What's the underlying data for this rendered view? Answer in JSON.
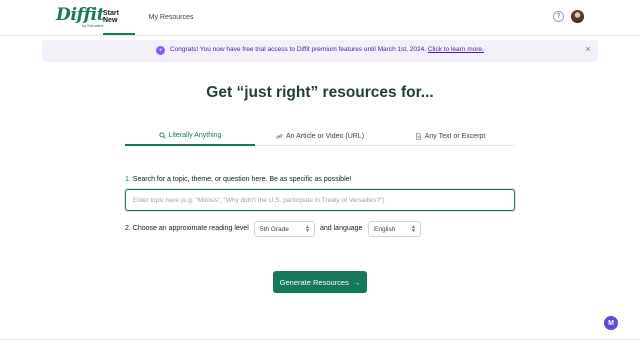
{
  "header": {
    "logo_text": "Diffit",
    "logo_sub": "by Edmates",
    "nav": [
      {
        "label": "Start New",
        "active": true
      },
      {
        "label": "My Resources",
        "active": false
      }
    ],
    "help_symbol": "?"
  },
  "banner": {
    "icon": "+",
    "text": "Congrats! You now have free trial access to Diffit premium features until March 1st, 2024.",
    "link_text": "Click to learn more.",
    "close_symbol": "×"
  },
  "headline": "Get “just right” resources for...",
  "tabs": [
    {
      "label": "Literally Anything",
      "icon": "search-icon",
      "active": true
    },
    {
      "label": "An Article or Video (URL)",
      "icon": "link-icon",
      "active": false
    },
    {
      "label": "Any Text or Excerpt",
      "icon": "document-icon",
      "active": false
    }
  ],
  "form": {
    "step1_num": "1.",
    "step1_text": "Search for a topic, theme, or question here. Be as specific as possible!",
    "topic_placeholder": "Enter topic here (e.g. “Mitosis”, “Why didn't the U.S. participate in Treaty of Versailles?”)",
    "topic_value": "",
    "step2_text": "2. Choose an approximate reading level",
    "reading_level": "5th Grade",
    "and_language": "and language",
    "language": "English",
    "chevron": "⌃⌄"
  },
  "generate_button": {
    "label": "Generate Resources",
    "arrow": "→"
  },
  "chat": {
    "label": "M"
  },
  "colors": {
    "accent": "#16785a",
    "banner_bg": "#f3f0fa",
    "banner_text": "#4c1d95",
    "chat": "#5b4dd6"
  }
}
